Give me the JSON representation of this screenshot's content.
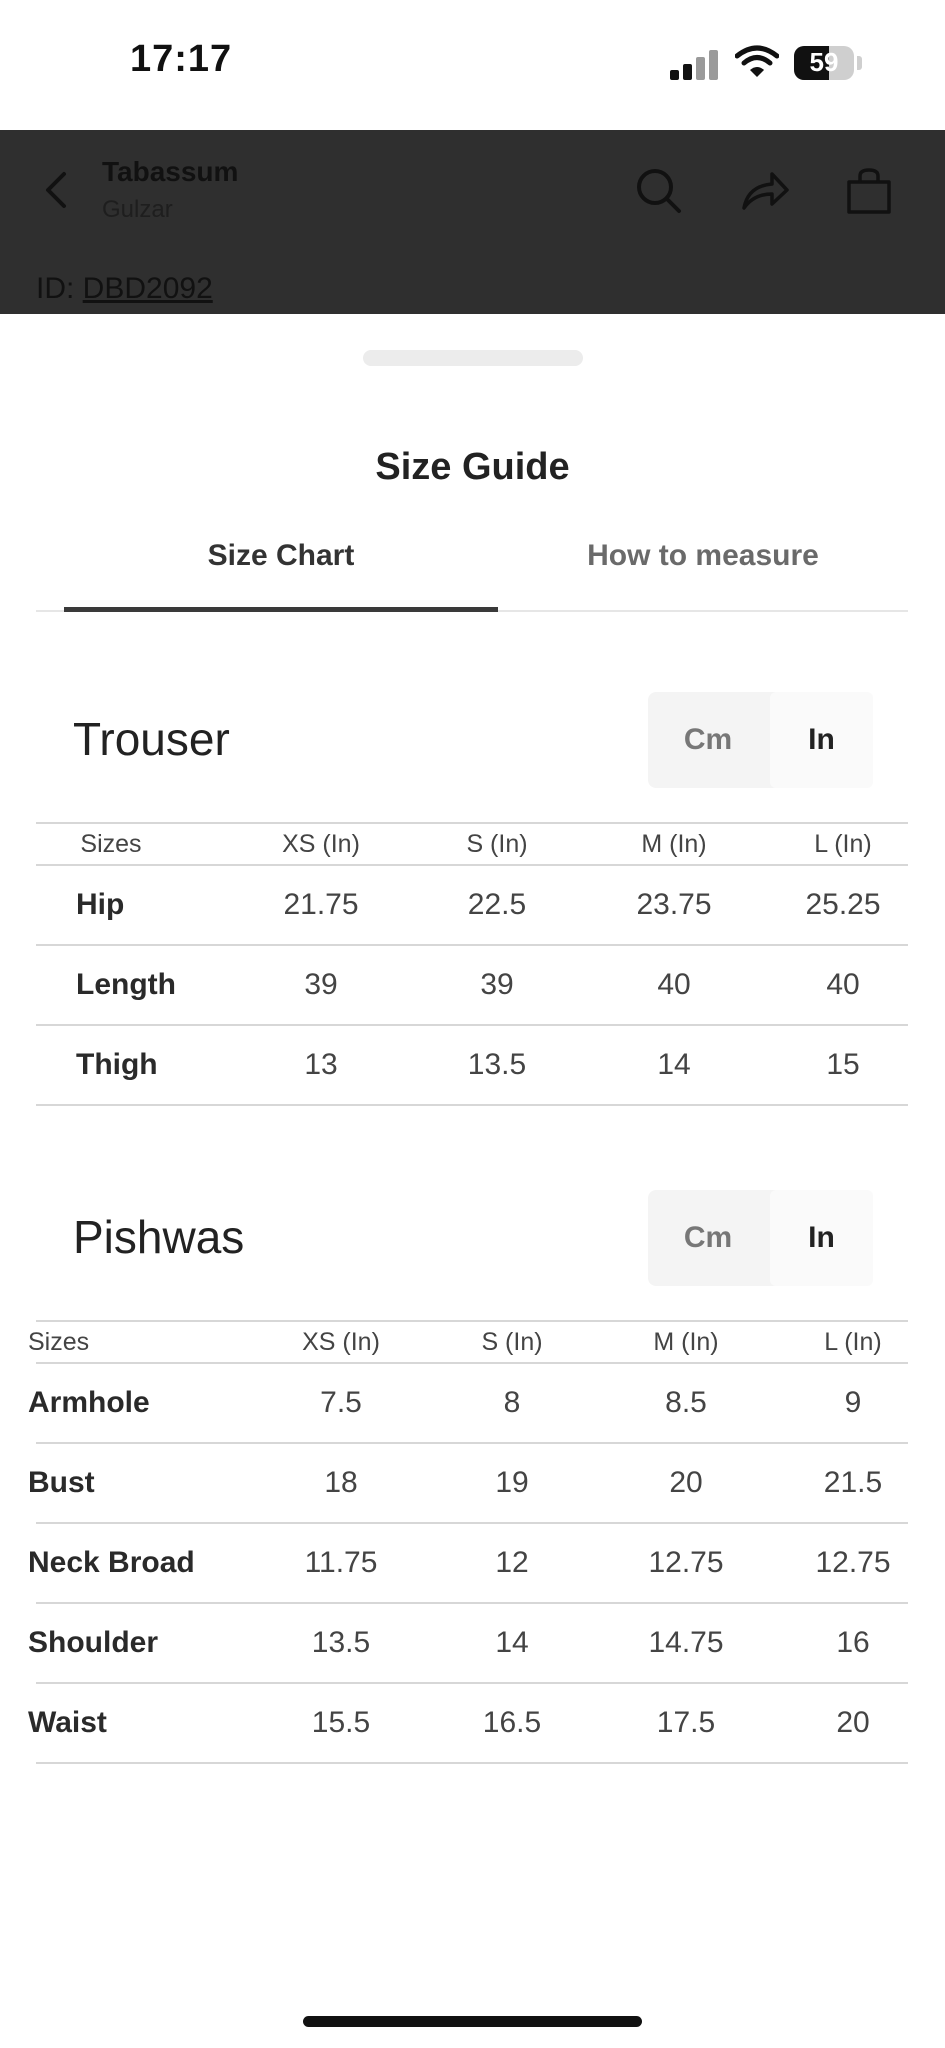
{
  "status_bar": {
    "time": "17:17",
    "battery": "59"
  },
  "header": {
    "title": "Tabassum",
    "subtitle": "Gulzar"
  },
  "id_row": {
    "label": "ID: ",
    "code": "DBD2092"
  },
  "sheet": {
    "title": "Size Guide",
    "tabs": [
      {
        "label": "Size Chart",
        "active": true
      },
      {
        "label": "How to measure",
        "active": false
      }
    ]
  },
  "sections": [
    {
      "title": "Trouser",
      "units": {
        "cm": "Cm",
        "in": "In",
        "selected": "In"
      },
      "headers": [
        "Sizes",
        "XS (In)",
        "S (In)",
        "M (In)",
        "L (In)"
      ],
      "rows": [
        {
          "label": "Hip",
          "values": [
            "21.75",
            "22.5",
            "23.75",
            "25.25"
          ]
        },
        {
          "label": "Length",
          "values": [
            "39",
            "39",
            "40",
            "40"
          ]
        },
        {
          "label": "Thigh",
          "values": [
            "13",
            "13.5",
            "14",
            "15"
          ]
        }
      ]
    },
    {
      "title": "Pishwas",
      "units": {
        "cm": "Cm",
        "in": "In",
        "selected": "In"
      },
      "headers": [
        "Sizes",
        "XS (In)",
        "S (In)",
        "M (In)",
        "L (In)"
      ],
      "rows": [
        {
          "label": "Armhole",
          "values": [
            "7.5",
            "8",
            "8.5",
            "9"
          ]
        },
        {
          "label": "Bust",
          "values": [
            "18",
            "19",
            "20",
            "21.5"
          ]
        },
        {
          "label": "Neck Broad",
          "values": [
            "11.75",
            "12",
            "12.75",
            "12.75"
          ]
        },
        {
          "label": "Shoulder",
          "values": [
            "13.5",
            "14",
            "14.75",
            "16"
          ]
        },
        {
          "label": "Waist",
          "values": [
            "15.5",
            "16.5",
            "17.5",
            "20"
          ]
        }
      ]
    }
  ],
  "colors": {
    "overlay_header": "#2f2f2f",
    "active_tab_underline": "#3a3a3a",
    "divider": "#d7d7d7"
  }
}
